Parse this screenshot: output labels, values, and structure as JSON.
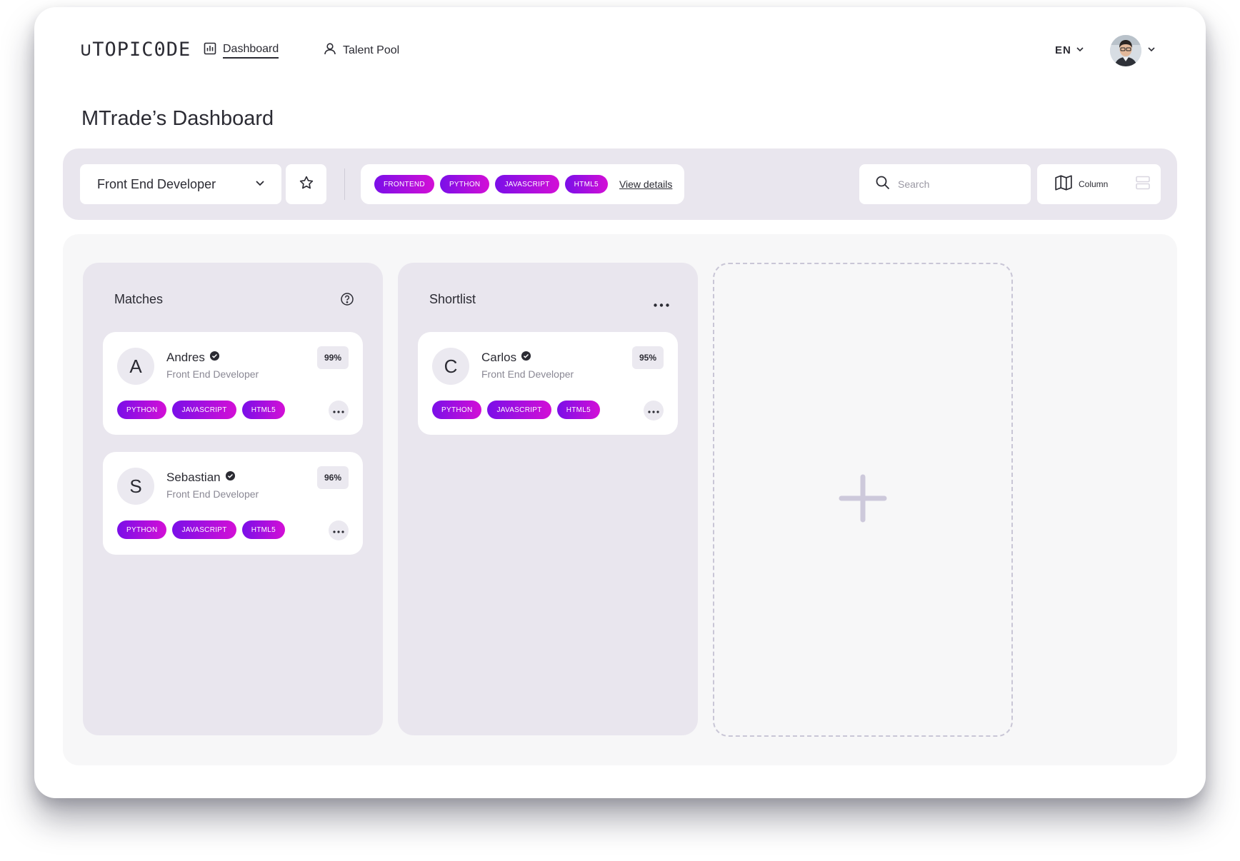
{
  "brand": {
    "logo_text": "∪TOPIC0DE"
  },
  "nav": {
    "items": [
      {
        "label": "Dashboard",
        "icon": "bar-chart-icon"
      },
      {
        "label": "Talent Pool",
        "icon": "user-icon"
      }
    ]
  },
  "header": {
    "language": "EN"
  },
  "page": {
    "title": "MTrade’s Dashboard"
  },
  "toolbar": {
    "role_select": "Front End Developer",
    "tags": [
      "FRONTEND",
      "PYTHON",
      "JAVASCRIPT",
      "HTML5"
    ],
    "view_details_label": "View details",
    "search_placeholder": "Search",
    "view_mode_label": "Column"
  },
  "columns": [
    {
      "title": "Matches",
      "action_icon": "help-circle-icon",
      "cards": [
        {
          "initial": "A",
          "name": "Andres",
          "role": "Front End Developer",
          "score": "99%",
          "tags": [
            "PYTHON",
            "JAVASCRIPT",
            "HTML5"
          ]
        },
        {
          "initial": "S",
          "name": "Sebastian",
          "role": "Front End Developer",
          "score": "96%",
          "tags": [
            "PYTHON",
            "JAVASCRIPT",
            "HTML5"
          ]
        }
      ]
    },
    {
      "title": "Shortlist",
      "action_icon": "more-horizontal-icon",
      "cards": [
        {
          "initial": "C",
          "name": "Carlos",
          "role": "Front End Developer",
          "score": "95%",
          "tags": [
            "PYTHON",
            "JAVASCRIPT",
            "HTML5"
          ]
        }
      ]
    }
  ],
  "colors": {
    "tag_gradient_start": "#7a0fe8",
    "tag_gradient_end": "#d30fd6",
    "toolbar_bg": "#e9e6ee",
    "column_bg": "#e9e6ee",
    "board_bg": "#f7f7f8",
    "text": "#2b2b33"
  }
}
